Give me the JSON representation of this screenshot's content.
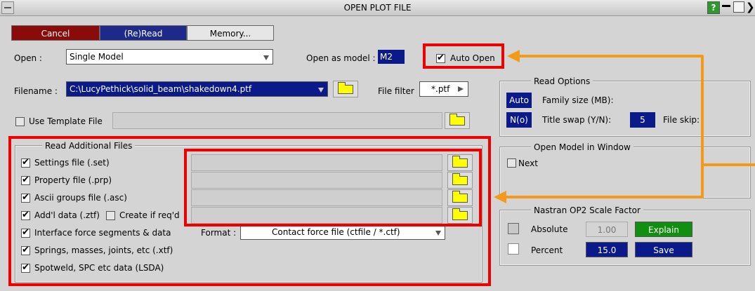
{
  "window": {
    "title": "OPEN PLOT FILE",
    "help_label": "?"
  },
  "toolbar": {
    "cancel_label": "Cancel",
    "reread_label": "(Re)Read",
    "memory_label": "Memory..."
  },
  "open": {
    "label": "Open :",
    "value": "Single Model",
    "model_label": "Open as model :",
    "model_value": "M2",
    "auto_open_label": "Auto Open",
    "auto_open_checked": true
  },
  "filename": {
    "label": "Filename :",
    "value": "C:\\LucyPethick\\solid_beam\\shakedown4.ptf",
    "filter_label": "File filter",
    "filter_value": "*.ptf"
  },
  "template": {
    "label": "Use Template File",
    "checked": false
  },
  "read_options": {
    "title": "Read Options",
    "family_btn": "Auto",
    "family_label": "Family size (MB):",
    "title_swap_btn": "N(o)",
    "title_swap_label": "Title swap (Y/N):",
    "skip_value": "5",
    "skip_label": "File skip:"
  },
  "additional": {
    "title": "Read Additional Files",
    "items": [
      {
        "label": "Settings file (.set)",
        "checked": true
      },
      {
        "label": "Property file (.prp)",
        "checked": true
      },
      {
        "label": "Ascii groups file (.asc)",
        "checked": true
      },
      {
        "label": "Add'l data (.ztf)",
        "checked": true
      },
      {
        "label": "Interface force segments & data",
        "checked": true
      },
      {
        "label": "Springs, masses, joints, etc (.xtf)",
        "checked": true
      },
      {
        "label": "Spotweld, SPC etc data (LSDA)",
        "checked": true
      }
    ],
    "create_label": "Create if req'd",
    "format_label": "Format :",
    "format_value": "Contact force file (ctfile / *.ctf)"
  },
  "open_model_window": {
    "title": "Open Model in Window",
    "next_label": "Next"
  },
  "nastran": {
    "title": "Nastran OP2 Scale Factor",
    "absolute_label": "Absolute",
    "absolute_value": "1.00",
    "explain_label": "Explain",
    "percent_label": "Percent",
    "percent_value": "15.0",
    "save_label": "Save"
  },
  "colors": {
    "annotation_red": "#ee0000",
    "annotation_orange": "#f39a1a",
    "cancel": "#8b0a0a",
    "navy": "#0b1a8a",
    "green": "#118f11"
  }
}
